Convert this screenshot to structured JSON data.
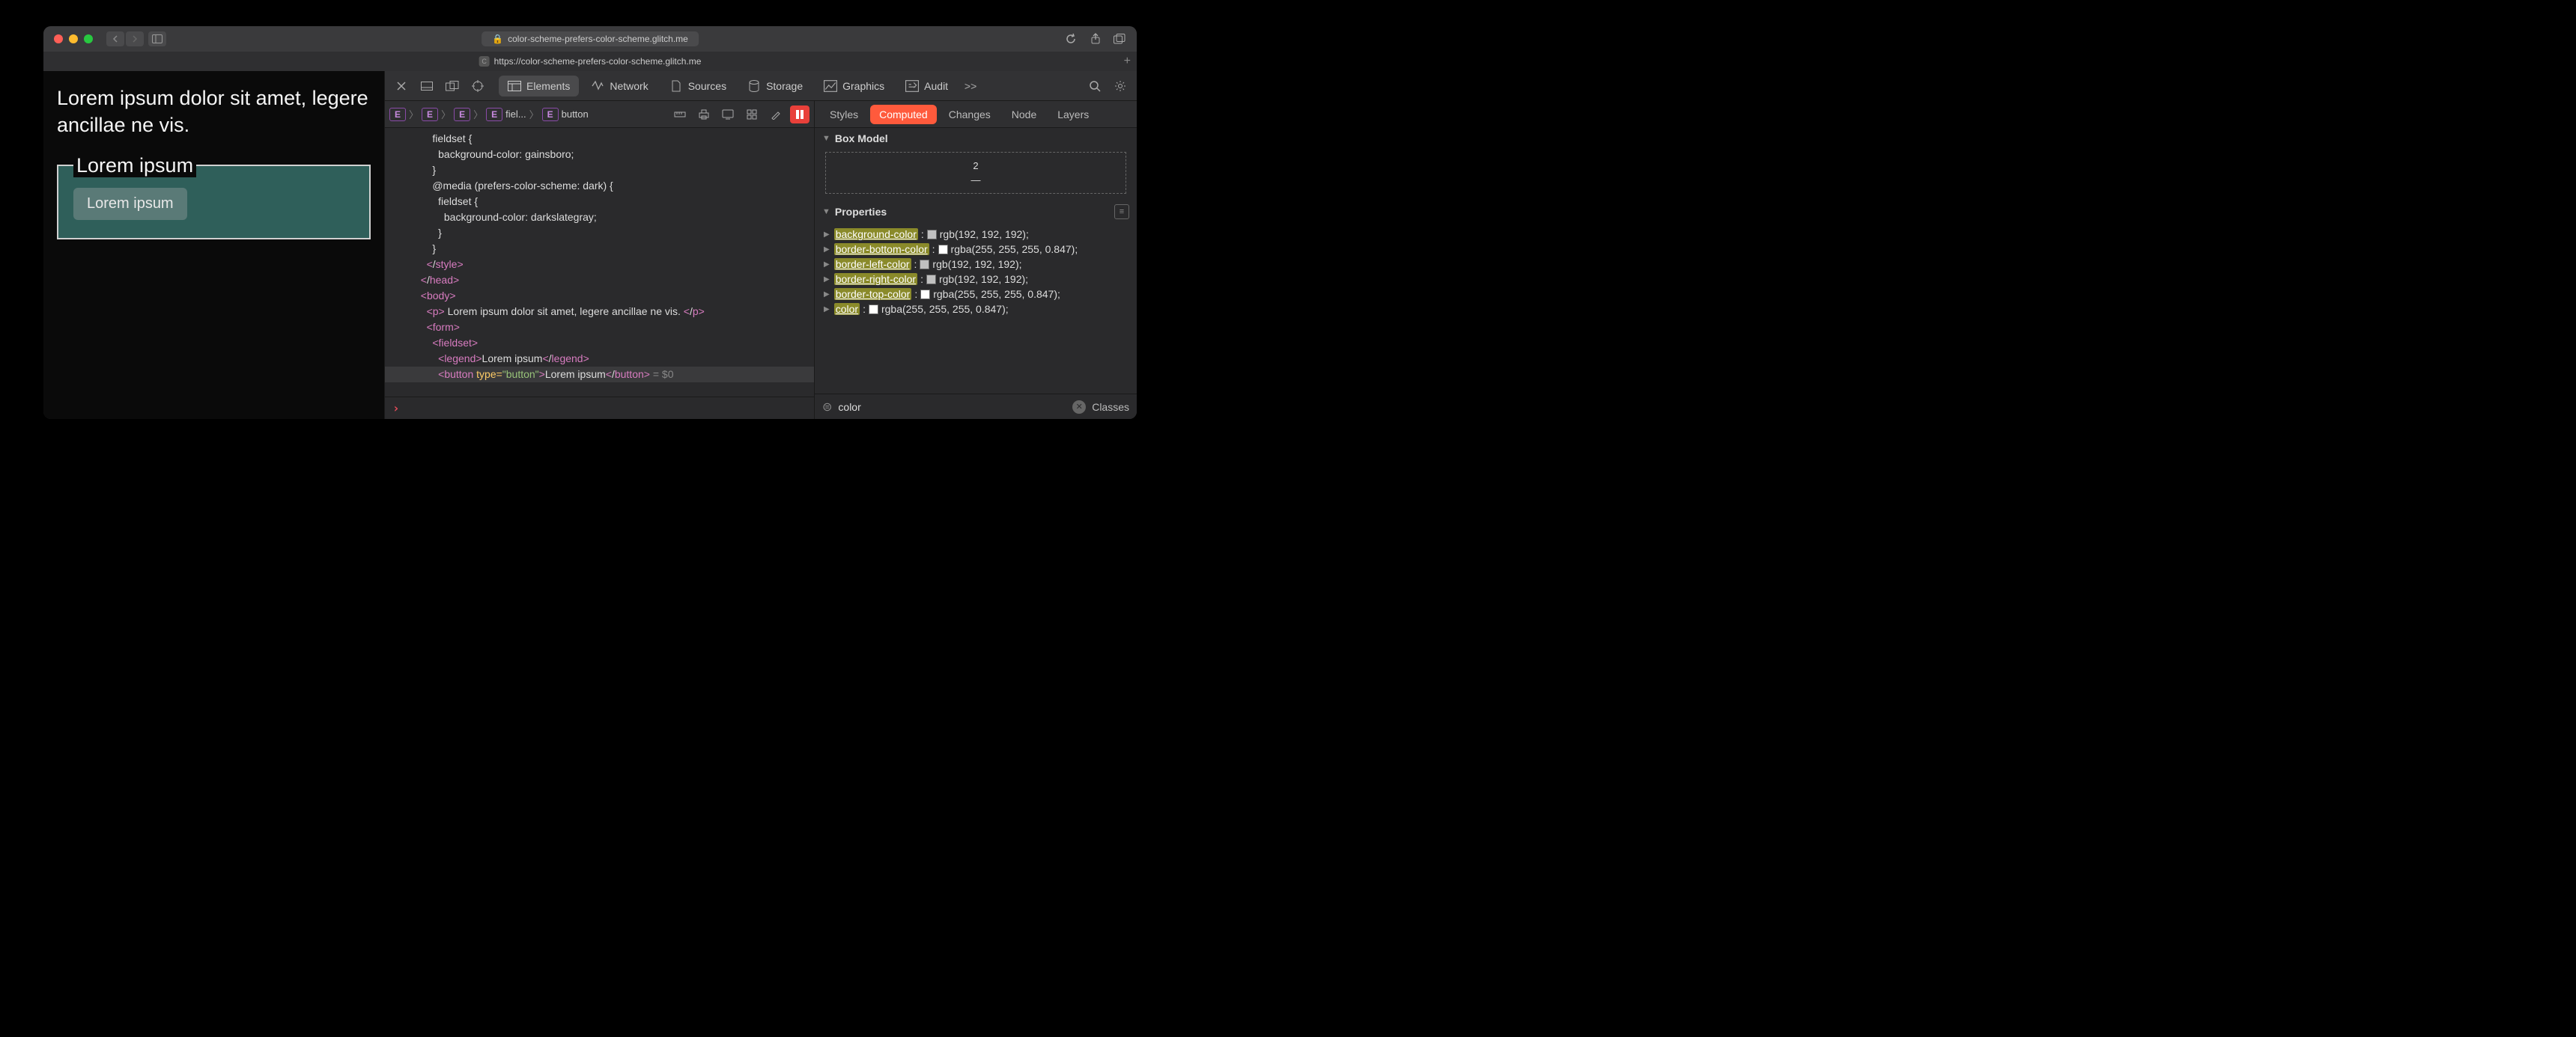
{
  "titlebar": {
    "url_display": "color-scheme-prefers-color-scheme.glitch.me",
    "lock_icon": "lock-icon"
  },
  "tab": {
    "favicon_letter": "C",
    "title": "https://color-scheme-prefers-color-scheme.glitch.me"
  },
  "page": {
    "paragraph": "Lorem ipsum dolor sit amet, legere ancillae ne vis.",
    "legend": "Lorem ipsum",
    "button_label": "Lorem ipsum"
  },
  "devtools": {
    "tabs": [
      "Elements",
      "Network",
      "Sources",
      "Storage",
      "Graphics",
      "Audit"
    ],
    "active_tab": "Elements",
    "overflow_icon": ">>",
    "breadcrumb": [
      {
        "tag": "E",
        "label": ""
      },
      {
        "tag": "E",
        "label": ""
      },
      {
        "tag": "E",
        "label": ""
      },
      {
        "tag": "E",
        "label": "fiel..."
      },
      {
        "tag": "E",
        "label": "button"
      }
    ],
    "dom_lines": [
      "      fieldset {",
      "        background-color: gainsboro;",
      "      }",
      "      @media (prefers-color-scheme: dark) {",
      "        fieldset {",
      "          background-color: darkslategray;",
      "        }",
      "      }",
      "    </style>",
      "  </head>",
      "  <body>",
      "    <p> Lorem ipsum dolor sit amet, legere ancillae ne vis. </p>",
      "    <form>",
      "      <fieldset>",
      "        <legend>Lorem ipsum</legend>",
      "        <button type=\"button\">Lorem ipsum</button> = $0"
    ]
  },
  "right_panel": {
    "tabs": [
      "Styles",
      "Computed",
      "Changes",
      "Node",
      "Layers"
    ],
    "active_tab": "Computed",
    "box_model": {
      "header": "Box Model",
      "top": "2",
      "mid": "—"
    },
    "properties_header": "Properties",
    "properties": [
      {
        "name": "background-color",
        "swatch": "#c0c0c0",
        "value": "rgb(192, 192, 192);"
      },
      {
        "name": "border-bottom-color",
        "swatch": "#ffffff",
        "value": "rgba(255, 255, 255, 0.847);"
      },
      {
        "name": "border-left-color",
        "swatch": "#c0c0c0",
        "value": "rgb(192, 192, 192);"
      },
      {
        "name": "border-right-color",
        "swatch": "#c0c0c0",
        "value": "rgb(192, 192, 192);"
      },
      {
        "name": "border-top-color",
        "swatch": "#ffffff",
        "value": "rgba(255, 255, 255, 0.847);"
      },
      {
        "name": "color",
        "swatch": "#ffffff",
        "value": "rgba(255, 255, 255, 0.847);"
      }
    ],
    "filter_value": "color",
    "classes_label": "Classes"
  }
}
